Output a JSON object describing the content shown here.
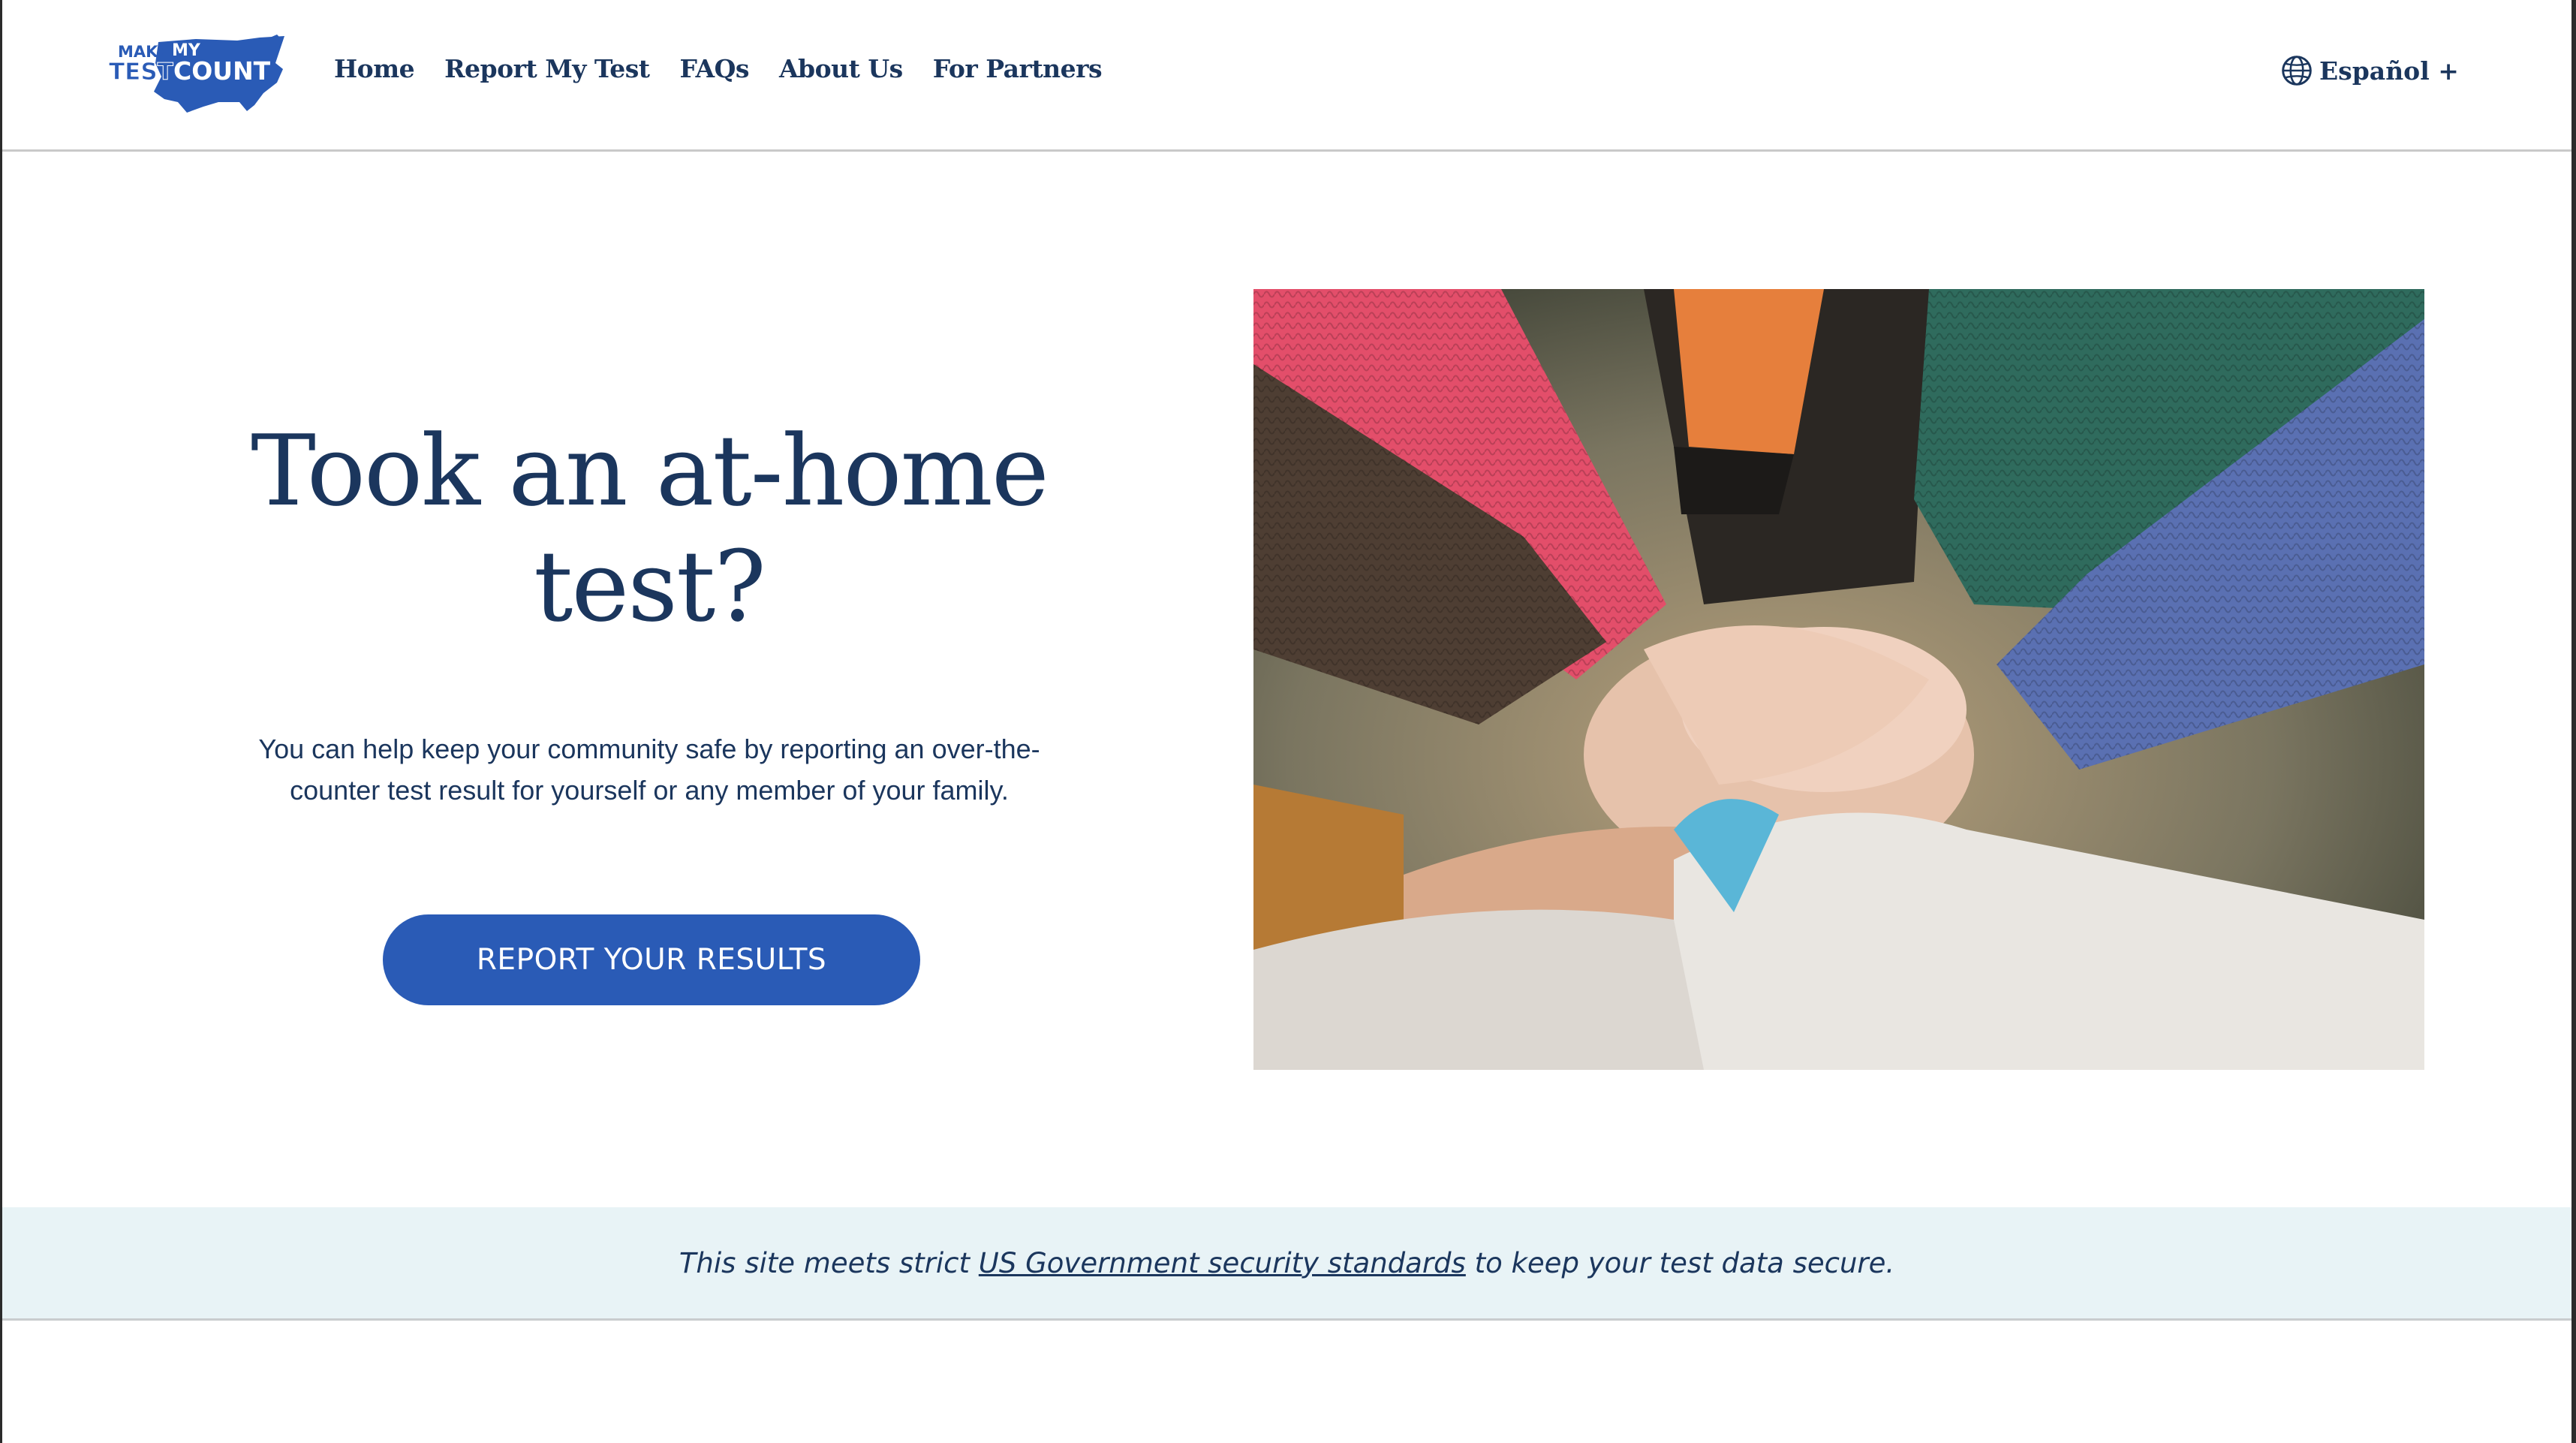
{
  "header": {
    "logo": {
      "line1_a": "MAKE",
      "line1_b": "MY",
      "line2_a": "TEST",
      "line2_b": "COUNT"
    },
    "nav": [
      {
        "label": "Home"
      },
      {
        "label": "Report My Test"
      },
      {
        "label": "FAQs"
      },
      {
        "label": "About Us"
      },
      {
        "label": "For Partners"
      }
    ],
    "language_label": "Español +"
  },
  "hero": {
    "title_line1": "Took an at-home",
    "title_line2": "test?",
    "body": "You can help keep your community safe by reporting an over-the-counter test result for yourself or any member of your family.",
    "cta_label": "REPORT YOUR RESULTS"
  },
  "banner": {
    "prefix": "This site meets strict ",
    "link_text": "US Government security standards",
    "suffix": " to keep your test data secure."
  },
  "colors": {
    "navy": "#1b365d",
    "button_blue": "#2a5bb6",
    "banner_bg": "#e8f3f6"
  }
}
